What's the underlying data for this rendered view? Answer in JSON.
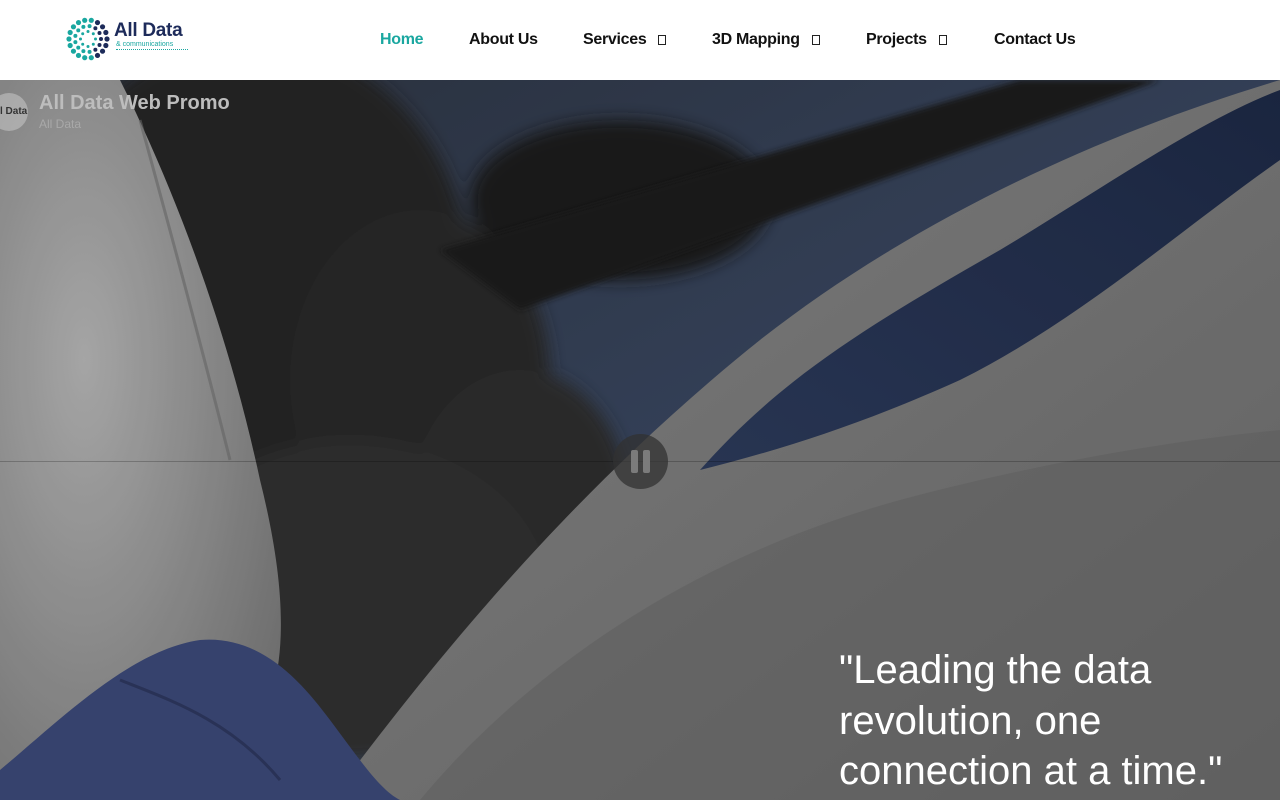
{
  "brand": {
    "name": "All Data",
    "tagline": "& communications",
    "primary_color": "#1d2b5a",
    "accent_color": "#1aa7a0"
  },
  "nav": {
    "items": [
      {
        "label": "Home",
        "active": true,
        "dropdown": false
      },
      {
        "label": "About Us",
        "active": false,
        "dropdown": false
      },
      {
        "label": "Services",
        "active": false,
        "dropdown": true
      },
      {
        "label": "3D Mapping",
        "active": false,
        "dropdown": true
      },
      {
        "label": "Projects",
        "active": false,
        "dropdown": true
      },
      {
        "label": "Contact Us",
        "active": false,
        "dropdown": false
      }
    ],
    "active_color": "#1aa7a0"
  },
  "video": {
    "title": "All Data Web Promo",
    "channel": "All Data",
    "avatar_text": "l Data",
    "state_icon": "pause-icon"
  },
  "hero": {
    "quote_lines": [
      "\"Leading the data",
      "revolution, one",
      "connection at a time.\""
    ]
  }
}
